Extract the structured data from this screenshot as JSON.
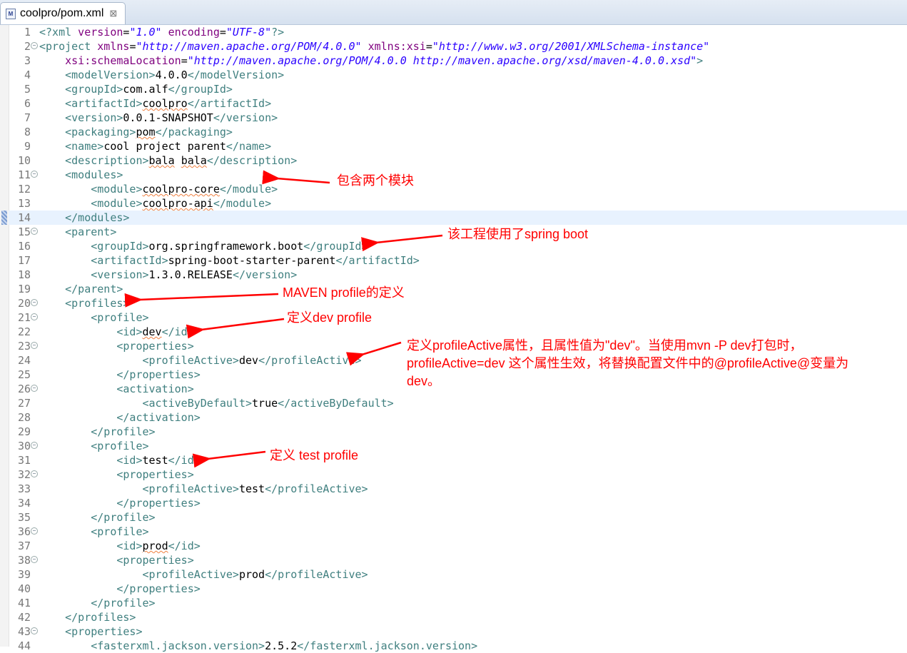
{
  "tab": {
    "icon": "maven-pom-file-icon",
    "icon_label": "M",
    "title": "coolpro/pom.xml",
    "close": "⊠"
  },
  "current_line": 14,
  "folds": [
    2,
    11,
    15,
    20,
    21,
    23,
    26,
    30,
    32,
    36,
    38,
    43
  ],
  "lines": [
    [
      [
        "t",
        "<?xml"
      ],
      [
        "a",
        " version"
      ],
      [
        "x",
        "="
      ],
      [
        "v",
        "\"1.0\""
      ],
      [
        "a",
        " encoding"
      ],
      [
        "x",
        "="
      ],
      [
        "v",
        "\"UTF-8\""
      ],
      [
        "t",
        "?>"
      ]
    ],
    [
      [
        "t",
        "<project"
      ],
      [
        "a",
        " xmlns"
      ],
      [
        "x",
        "="
      ],
      [
        "v",
        "\"http://maven.apache.org/POM/4.0.0\""
      ],
      [
        "a",
        " xmlns:xsi"
      ],
      [
        "x",
        "="
      ],
      [
        "v",
        "\"http://www.w3.org/2001/XMLSchema-instance\""
      ]
    ],
    [
      [
        "x",
        "    "
      ],
      [
        "a",
        "xsi:schemaLocation"
      ],
      [
        "x",
        "="
      ],
      [
        "v",
        "\"http://maven.apache.org/POM/4.0.0 http://maven.apache.org/xsd/maven-4.0.0.xsd\""
      ],
      [
        "t",
        ">"
      ]
    ],
    [
      [
        "x",
        "    "
      ],
      [
        "t",
        "<modelVersion>"
      ],
      [
        "x",
        "4.0.0"
      ],
      [
        "t",
        "</modelVersion>"
      ]
    ],
    [
      [
        "x",
        "    "
      ],
      [
        "t",
        "<groupId>"
      ],
      [
        "x",
        "com.alf"
      ],
      [
        "t",
        "</groupId>"
      ]
    ],
    [
      [
        "x",
        "    "
      ],
      [
        "t",
        "<artifactId>"
      ],
      [
        "s",
        "coolpro"
      ],
      [
        "t",
        "</artifactId>"
      ]
    ],
    [
      [
        "x",
        "    "
      ],
      [
        "t",
        "<version>"
      ],
      [
        "x",
        "0.0.1-SNAPSHOT"
      ],
      [
        "t",
        "</version>"
      ]
    ],
    [
      [
        "x",
        "    "
      ],
      [
        "t",
        "<packaging>"
      ],
      [
        "s",
        "pom"
      ],
      [
        "t",
        "</packaging>"
      ]
    ],
    [
      [
        "x",
        "    "
      ],
      [
        "t",
        "<name>"
      ],
      [
        "x",
        "cool project parent"
      ],
      [
        "t",
        "</name>"
      ]
    ],
    [
      [
        "x",
        "    "
      ],
      [
        "t",
        "<description>"
      ],
      [
        "s",
        "bala"
      ],
      [
        "x",
        " "
      ],
      [
        "s",
        "bala"
      ],
      [
        "t",
        "</description>"
      ]
    ],
    [
      [
        "x",
        "    "
      ],
      [
        "t",
        "<modules>"
      ]
    ],
    [
      [
        "x",
        "        "
      ],
      [
        "t",
        "<module>"
      ],
      [
        "s",
        "coolpro-core"
      ],
      [
        "t",
        "</module>"
      ]
    ],
    [
      [
        "x",
        "        "
      ],
      [
        "t",
        "<module>"
      ],
      [
        "s",
        "coolpro-api"
      ],
      [
        "t",
        "</module>"
      ]
    ],
    [
      [
        "x",
        "    "
      ],
      [
        "t",
        "</modules>"
      ]
    ],
    [
      [
        "x",
        "    "
      ],
      [
        "t",
        "<parent>"
      ]
    ],
    [
      [
        "x",
        "        "
      ],
      [
        "t",
        "<groupId>"
      ],
      [
        "x",
        "org.springframework.boot"
      ],
      [
        "t",
        "</groupId>"
      ]
    ],
    [
      [
        "x",
        "        "
      ],
      [
        "t",
        "<artifactId>"
      ],
      [
        "x",
        "spring-boot-starter-parent"
      ],
      [
        "t",
        "</artifactId>"
      ]
    ],
    [
      [
        "x",
        "        "
      ],
      [
        "t",
        "<version>"
      ],
      [
        "x",
        "1.3.0.RELEASE"
      ],
      [
        "t",
        "</version>"
      ]
    ],
    [
      [
        "x",
        "    "
      ],
      [
        "t",
        "</parent>"
      ]
    ],
    [
      [
        "x",
        "    "
      ],
      [
        "t",
        "<profiles>"
      ]
    ],
    [
      [
        "x",
        "        "
      ],
      [
        "t",
        "<profile>"
      ]
    ],
    [
      [
        "x",
        "            "
      ],
      [
        "t",
        "<id>"
      ],
      [
        "s",
        "dev"
      ],
      [
        "t",
        "</id>"
      ]
    ],
    [
      [
        "x",
        "            "
      ],
      [
        "t",
        "<properties>"
      ]
    ],
    [
      [
        "x",
        "                "
      ],
      [
        "t",
        "<profileActive>"
      ],
      [
        "x",
        "dev"
      ],
      [
        "t",
        "</profileActive>"
      ]
    ],
    [
      [
        "x",
        "            "
      ],
      [
        "t",
        "</properties>"
      ]
    ],
    [
      [
        "x",
        "            "
      ],
      [
        "t",
        "<activation>"
      ]
    ],
    [
      [
        "x",
        "                "
      ],
      [
        "t",
        "<activeByDefault>"
      ],
      [
        "x",
        "true"
      ],
      [
        "t",
        "</activeByDefault>"
      ]
    ],
    [
      [
        "x",
        "            "
      ],
      [
        "t",
        "</activation>"
      ]
    ],
    [
      [
        "x",
        "        "
      ],
      [
        "t",
        "</profile>"
      ]
    ],
    [
      [
        "x",
        "        "
      ],
      [
        "t",
        "<profile>"
      ]
    ],
    [
      [
        "x",
        "            "
      ],
      [
        "t",
        "<id>"
      ],
      [
        "x",
        "test"
      ],
      [
        "t",
        "</id>"
      ]
    ],
    [
      [
        "x",
        "            "
      ],
      [
        "t",
        "<properties>"
      ]
    ],
    [
      [
        "x",
        "                "
      ],
      [
        "t",
        "<profileActive>"
      ],
      [
        "x",
        "test"
      ],
      [
        "t",
        "</profileActive>"
      ]
    ],
    [
      [
        "x",
        "            "
      ],
      [
        "t",
        "</properties>"
      ]
    ],
    [
      [
        "x",
        "        "
      ],
      [
        "t",
        "</profile>"
      ]
    ],
    [
      [
        "x",
        "        "
      ],
      [
        "t",
        "<profile>"
      ]
    ],
    [
      [
        "x",
        "            "
      ],
      [
        "t",
        "<id>"
      ],
      [
        "s",
        "prod"
      ],
      [
        "t",
        "</id>"
      ]
    ],
    [
      [
        "x",
        "            "
      ],
      [
        "t",
        "<properties>"
      ]
    ],
    [
      [
        "x",
        "                "
      ],
      [
        "t",
        "<profileActive>"
      ],
      [
        "x",
        "prod"
      ],
      [
        "t",
        "</profileActive>"
      ]
    ],
    [
      [
        "x",
        "            "
      ],
      [
        "t",
        "</properties>"
      ]
    ],
    [
      [
        "x",
        "        "
      ],
      [
        "t",
        "</profile>"
      ]
    ],
    [
      [
        "x",
        "    "
      ],
      [
        "t",
        "</profiles>"
      ]
    ],
    [
      [
        "x",
        "    "
      ],
      [
        "t",
        "<properties>"
      ]
    ],
    [
      [
        "x",
        "        "
      ],
      [
        "t",
        "<fasterxml.jackson.version>"
      ],
      [
        "x",
        "2.5.2"
      ],
      [
        "t",
        "</fasterxml.jackson.version>"
      ]
    ]
  ],
  "annotations": {
    "modules": "包含两个模块",
    "spring_boot": "该工程使用了spring boot",
    "profiles": "MAVEN profile的定义",
    "dev_profile": "定义dev profile",
    "profile_active_1": "定义profileActive属性，且属性值为\"dev\"。当使用mvn -P dev打包时，",
    "profile_active_2": "profileActive=dev 这个属性生效，将替换配置文件中的@profileActive@变量为",
    "profile_active_3": "dev。",
    "test_profile": "定义 test profile"
  },
  "colors": {
    "tag": "#3f7f7f",
    "attr": "#7f007f",
    "value": "#2a00ff",
    "annotation": "#ff0000",
    "current_line": "#e8f2fe"
  }
}
